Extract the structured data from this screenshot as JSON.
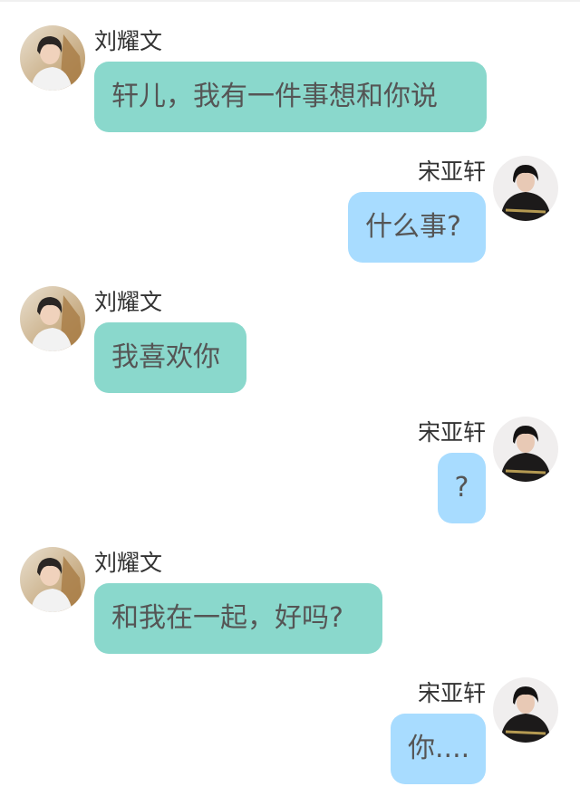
{
  "colors": {
    "left_bubble": "#8ad8cc",
    "right_bubble": "#a8dcff",
    "name_text": "#333333",
    "message_text": "#555555",
    "background": "#ffffff"
  },
  "messages": [
    {
      "side": "left",
      "sender": "刘耀文",
      "avatar": "avatar-liu-yaowen",
      "text": "轩儿，我有一件事想和你说"
    },
    {
      "side": "right",
      "sender": "宋亚轩",
      "avatar": "avatar-song-yaxuan",
      "text": "什么事?"
    },
    {
      "side": "left",
      "sender": "刘耀文",
      "avatar": "avatar-liu-yaowen",
      "text": "我喜欢你"
    },
    {
      "side": "right",
      "sender": "宋亚轩",
      "avatar": "avatar-song-yaxuan",
      "text": "?"
    },
    {
      "side": "left",
      "sender": "刘耀文",
      "avatar": "avatar-liu-yaowen",
      "text": "和我在一起，好吗?"
    },
    {
      "side": "right",
      "sender": "宋亚轩",
      "avatar": "avatar-song-yaxuan",
      "text": "你...."
    }
  ]
}
